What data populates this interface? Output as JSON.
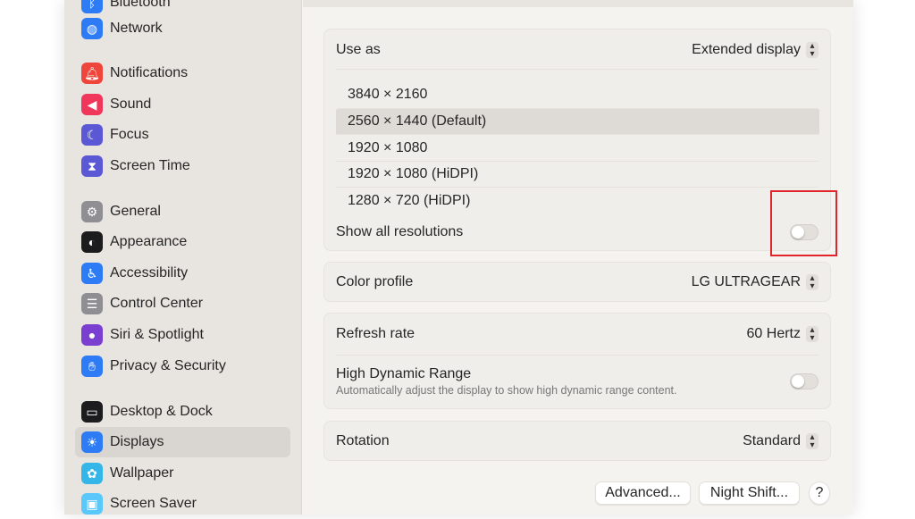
{
  "sidebar": {
    "items": [
      {
        "label": "Bluetooth",
        "icon": "bluetooth-icon",
        "color": "#2d7cf6"
      },
      {
        "label": "Network",
        "icon": "globe-icon",
        "color": "#2d7cf6"
      },
      {
        "label": "Notifications",
        "icon": "bell-icon",
        "color": "#f0453a"
      },
      {
        "label": "Sound",
        "icon": "speaker-icon",
        "color": "#f0365a"
      },
      {
        "label": "Focus",
        "icon": "moon-icon",
        "color": "#5b58d6"
      },
      {
        "label": "Screen Time",
        "icon": "hourglass-icon",
        "color": "#5b58d6"
      },
      {
        "label": "General",
        "icon": "gear-icon",
        "color": "#8e8e93"
      },
      {
        "label": "Appearance",
        "icon": "appearance-icon",
        "color": "#1c1c1e"
      },
      {
        "label": "Accessibility",
        "icon": "accessibility-icon",
        "color": "#2d7cf6"
      },
      {
        "label": "Control Center",
        "icon": "toggles-icon",
        "color": "#8e8e93"
      },
      {
        "label": "Siri & Spotlight",
        "icon": "siri-icon",
        "color": "#7a3fd0"
      },
      {
        "label": "Privacy & Security",
        "icon": "hand-icon",
        "color": "#2d7cf6"
      },
      {
        "label": "Desktop & Dock",
        "icon": "dock-icon",
        "color": "#1c1c1e"
      },
      {
        "label": "Displays",
        "icon": "sun-icon",
        "color": "#2d7cf6"
      },
      {
        "label": "Wallpaper",
        "icon": "flower-icon",
        "color": "#35b6e8"
      },
      {
        "label": "Screen Saver",
        "icon": "screensaver-icon",
        "color": "#5ac8fa"
      }
    ],
    "selected": "Displays"
  },
  "main": {
    "use_as": {
      "label": "Use as",
      "value": "Extended display"
    },
    "resolutions": [
      "3840 × 2160",
      "2560 × 1440 (Default)",
      "1920 × 1080",
      "1920 × 1080 (HiDPI)",
      "1280 × 720 (HiDPI)"
    ],
    "selected_resolution": "2560 × 1440 (Default)",
    "show_all": {
      "label": "Show all resolutions",
      "on": false
    },
    "color_profile": {
      "label": "Color profile",
      "value": "LG ULTRAGEAR"
    },
    "refresh_rate": {
      "label": "Refresh rate",
      "value": "60 Hertz"
    },
    "hdr": {
      "label": "High Dynamic Range",
      "desc": "Automatically adjust the display to show high dynamic range content.",
      "on": false
    },
    "rotation": {
      "label": "Rotation",
      "value": "Standard"
    },
    "buttons": {
      "advanced": "Advanced...",
      "night_shift": "Night Shift...",
      "help": "?"
    }
  },
  "highlight_color": "#e0262b"
}
